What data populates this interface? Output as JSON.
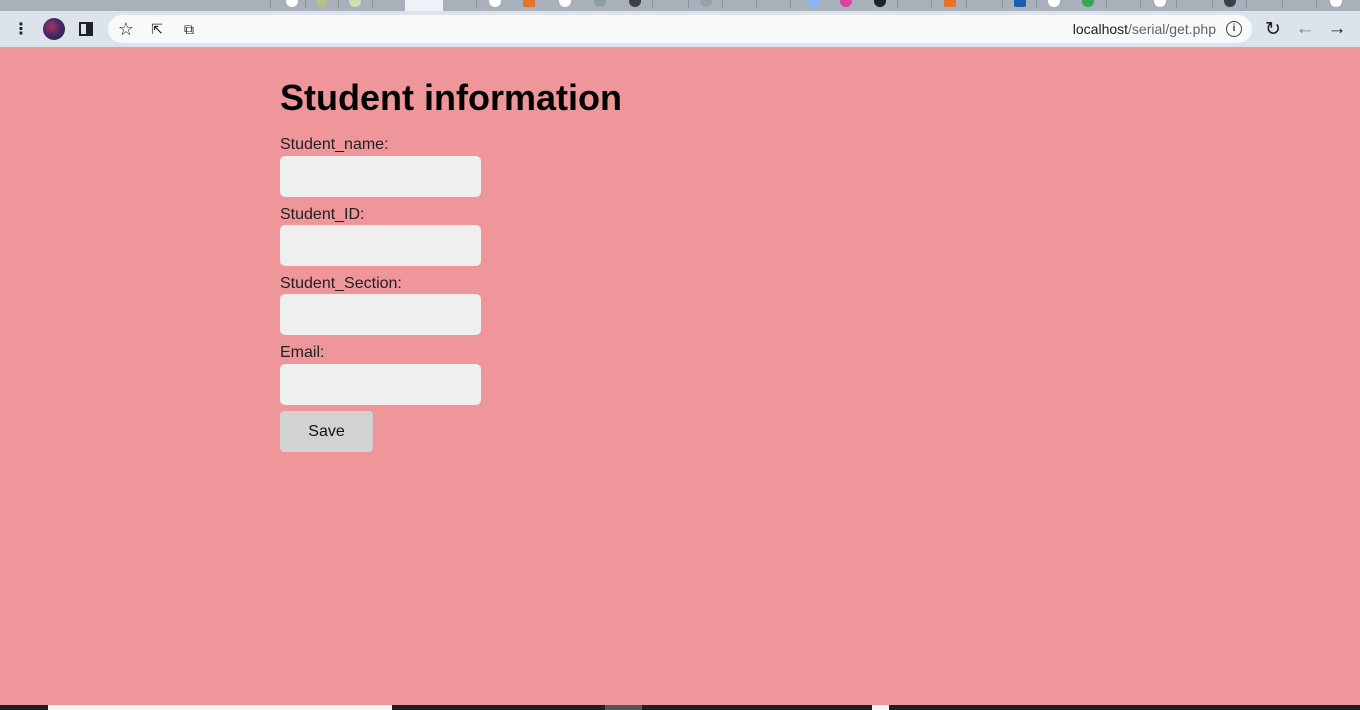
{
  "browser": {
    "url_host": "localhost",
    "url_path": "/serial/get.php",
    "icons": [
      "menu-icon",
      "profile-avatar",
      "side-panel-icon",
      "bookmark-star-icon",
      "share-icon",
      "cast-icon",
      "info-icon",
      "reload-icon",
      "back-icon",
      "forward-icon"
    ],
    "glyphs": {
      "menu": "⋮",
      "side_panel": "◧",
      "star": "☆",
      "share": "⇱",
      "cast": "⧉",
      "info": "i",
      "reload": "↻",
      "back": "←",
      "forward": "→"
    }
  },
  "form": {
    "title": "Student information",
    "fields": [
      {
        "label": "Student_name:",
        "value": ""
      },
      {
        "label": "Student_ID:",
        "value": ""
      },
      {
        "label": "Student_Section:",
        "value": ""
      },
      {
        "label": "Email:",
        "value": ""
      }
    ],
    "save_label": "Save"
  },
  "colors": {
    "page_background": "#ee9699",
    "input_background": "#efefef",
    "button_background": "#d2d2d2"
  }
}
